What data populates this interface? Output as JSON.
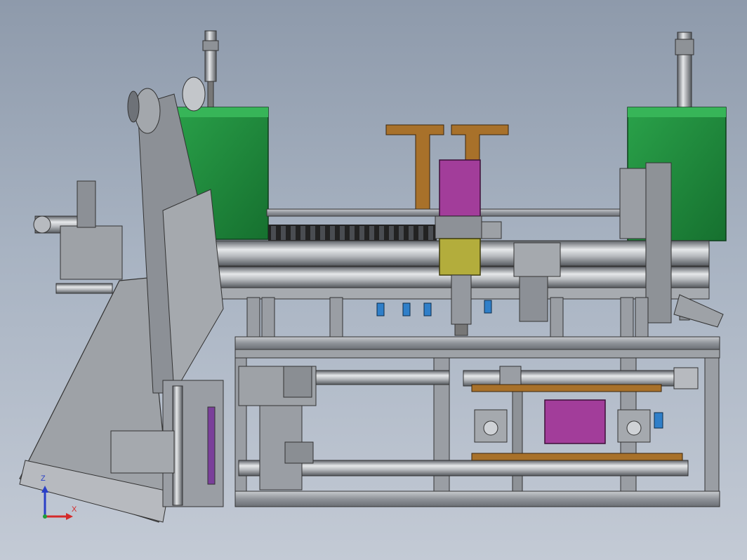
{
  "viewport": {
    "background_top": "#8e9aab",
    "background_bottom": "#c3cad5"
  },
  "triad": {
    "z_label": "Z",
    "x_label": "X",
    "z_color": "#2a3fc7",
    "x_color": "#d42a2a",
    "y_color": "#1e9e3a"
  },
  "palette": {
    "steel": "#9a9ea4",
    "steel_dark": "#6b6f75",
    "guard_green": "#1f8a3c",
    "magenta_block": "#a23d9a",
    "olive_block": "#b3ad3c",
    "bronze_plate": "#a8712a",
    "blue_fitting": "#2f7fc9"
  }
}
